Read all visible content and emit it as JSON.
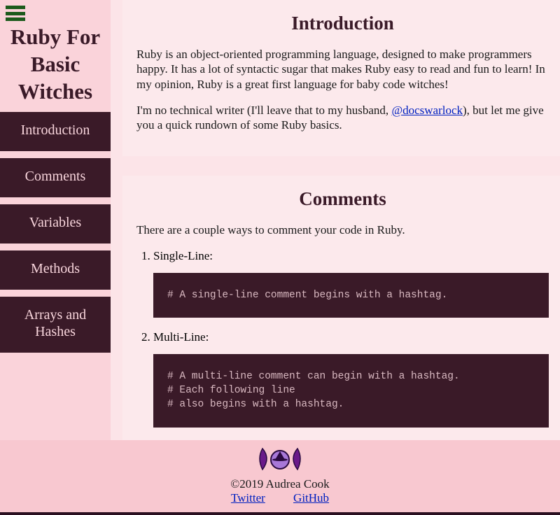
{
  "site_title": "Ruby For Basic Witches",
  "nav": [
    {
      "label": "Introduction"
    },
    {
      "label": "Comments"
    },
    {
      "label": "Variables"
    },
    {
      "label": "Methods"
    },
    {
      "label": "Arrays and Hashes"
    }
  ],
  "intro": {
    "heading": "Introduction",
    "p1": "Ruby is an object-oriented programming language, designed to make programmers happy. It has a lot of syntactic sugar that makes Ruby easy to read and fun to learn! In my opinion, Ruby is a great first language for baby code witches!",
    "p2_before": "I'm no technical writer (I'll leave that to my husband, ",
    "p2_link": "@docswarlock",
    "p2_after": "), but let me give you a quick rundown of some Ruby basics."
  },
  "comments": {
    "heading": "Comments",
    "p1": "There are a couple ways to comment your code in Ruby.",
    "item1_label": "Single-Line:",
    "item1_code": "# A single-line comment begins with a hashtag.",
    "item2_label": "Multi-Line:",
    "item2_code": "# A multi-line comment can begin with a hashtag.\n# Each following line\n# also begins with a hashtag."
  },
  "footer": {
    "copyright": "©2019 Audrea Cook",
    "twitter": "Twitter",
    "github": "GitHub"
  }
}
